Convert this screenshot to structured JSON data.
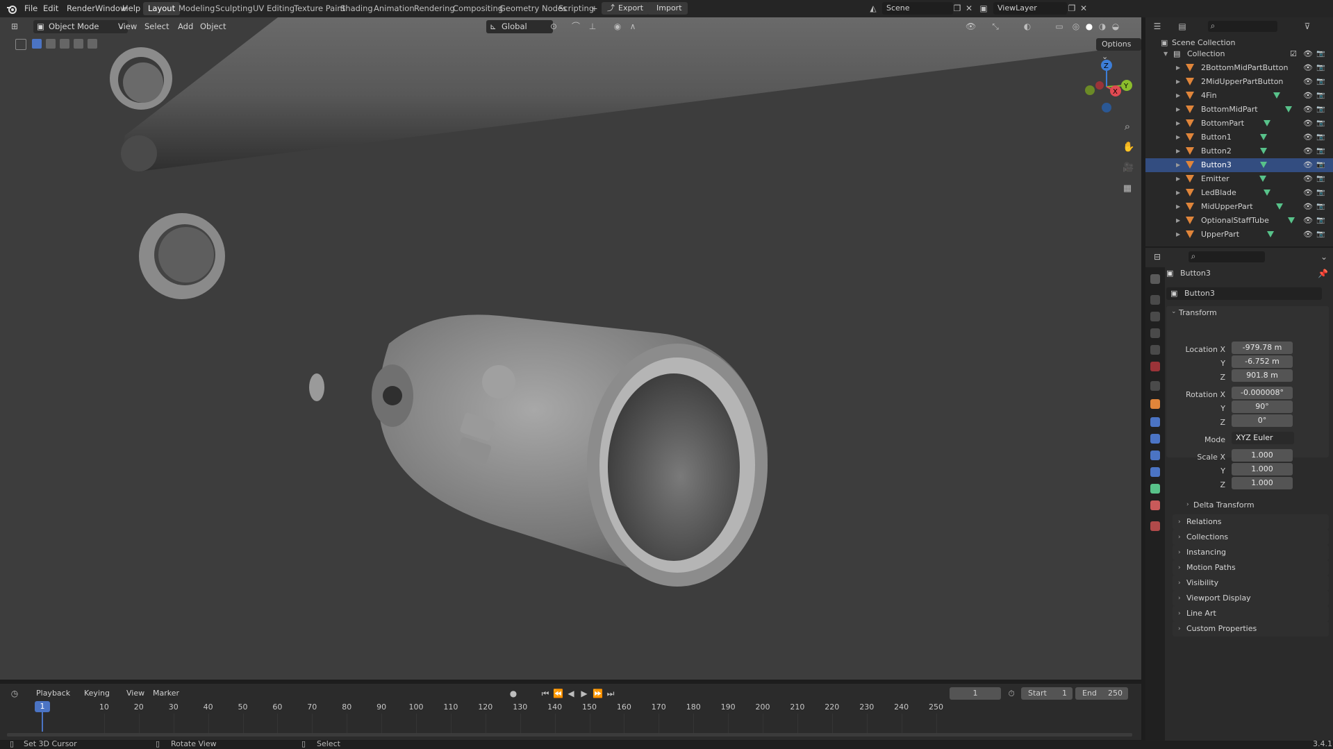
{
  "topbar": {
    "menus": [
      "File",
      "Edit",
      "Render",
      "Window",
      "Help"
    ],
    "workspaces": [
      "Layout",
      "Modeling",
      "Sculpting",
      "UV Editing",
      "Texture Paint",
      "Shading",
      "Animation",
      "Rendering",
      "Compositing",
      "Geometry Nodes",
      "Scripting"
    ],
    "active_workspace": "Layout",
    "add_tab": "+",
    "export_label": "Export",
    "import_label": "Import",
    "scene_name": "Scene",
    "view_layer": "ViewLayer"
  },
  "viewport": {
    "mode": "Object Mode",
    "menus": [
      "View",
      "Select",
      "Add",
      "Object"
    ],
    "transform_orientation": "Global",
    "options_label": "Options"
  },
  "outliner": {
    "scene_collection": "Scene Collection",
    "collection": "Collection",
    "items": [
      {
        "name": "2BottomMidPartButton",
        "has_data": false
      },
      {
        "name": "2MidUpperPartButton",
        "has_data": false
      },
      {
        "name": "4Fin",
        "has_data": true
      },
      {
        "name": "BottomMidPart",
        "has_data": true
      },
      {
        "name": "BottomPart",
        "has_data": true
      },
      {
        "name": "Button1",
        "has_data": true
      },
      {
        "name": "Button2",
        "has_data": true
      },
      {
        "name": "Button3",
        "has_data": true,
        "selected": true
      },
      {
        "name": "Emitter",
        "has_data": true
      },
      {
        "name": "LedBlade",
        "has_data": true
      },
      {
        "name": "MidUpperPart",
        "has_data": true
      },
      {
        "name": "OptionalStaffTube",
        "has_data": true
      },
      {
        "name": "UpperPart",
        "has_data": true
      }
    ]
  },
  "properties": {
    "object_name": "Button3",
    "object_datablock": "Button3",
    "transform_label": "Transform",
    "location_x_label": "Location X",
    "location_x": "-979.78 m",
    "location_y": "-6.752 m",
    "location_z": "901.8 m",
    "rotation_x_label": "Rotation X",
    "rotation_x": "-0.000008°",
    "rotation_y": "90°",
    "rotation_z": "0°",
    "mode_label": "Mode",
    "mode_value": "XYZ Euler",
    "scale_x_label": "Scale X",
    "scale_x": "1.000",
    "scale_y": "1.000",
    "scale_z": "1.000",
    "y_label": "Y",
    "z_label": "Z",
    "delta_transform": "Delta Transform",
    "panels": [
      "Relations",
      "Collections",
      "Instancing",
      "Motion Paths",
      "Visibility",
      "Viewport Display",
      "Line Art",
      "Custom Properties"
    ]
  },
  "timeline": {
    "menus": [
      "Playback",
      "Keying",
      "View",
      "Marker"
    ],
    "current_frame": "1",
    "start_label": "Start",
    "start_value": "1",
    "end_label": "End",
    "end_value": "250",
    "ticks": [
      "10",
      "20",
      "30",
      "40",
      "50",
      "60",
      "70",
      "80",
      "90",
      "100",
      "110",
      "120",
      "130",
      "140",
      "150",
      "160",
      "170",
      "180",
      "190",
      "200",
      "210",
      "220",
      "230",
      "240",
      "250"
    ]
  },
  "statusbar": {
    "left": "Set 3D Cursor",
    "middle": "Rotate View",
    "right": "Select",
    "version": "3.4.1"
  },
  "colors": {
    "selection": "#334d80",
    "object_icon": "#e0853a",
    "mesh_data_icon": "#58c28a",
    "axis_x": "#e04a52",
    "axis_y": "#8bbd2c",
    "axis_z": "#3d7ed8"
  }
}
